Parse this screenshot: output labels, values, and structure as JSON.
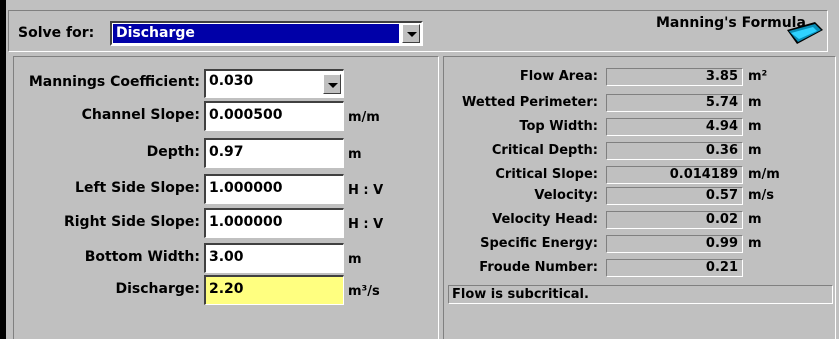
{
  "header": {
    "solve_for_label": "Solve for:",
    "solve_for_value": "Discharge",
    "formula_title": "Manning's Formula",
    "icon": "channel-icon"
  },
  "inputs": {
    "mannings": {
      "label": "Mannings Coefficient:",
      "value": "0.030"
    },
    "slope": {
      "label": "Channel Slope:",
      "value": "0.000500",
      "unit": "m/m"
    },
    "depth": {
      "label": "Depth:",
      "value": "0.97",
      "unit": "m"
    },
    "left_side": {
      "label": "Left Side Slope:",
      "value": "1.000000",
      "unit": "H : V"
    },
    "right_side": {
      "label": "Right Side Slope:",
      "value": "1.000000",
      "unit": "H : V"
    },
    "bottom_width": {
      "label": "Bottom Width:",
      "value": "3.00",
      "unit": "m"
    },
    "discharge": {
      "label": "Discharge:",
      "value": "2.20",
      "unit": "m³/s"
    }
  },
  "results": [
    {
      "label": "Flow Area:",
      "value": "3.85",
      "unit": "m²"
    },
    {
      "label": "Wetted Perimeter:",
      "value": "5.74",
      "unit": "m"
    },
    {
      "label": "Top Width:",
      "value": "4.94",
      "unit": "m"
    },
    {
      "label": "Critical Depth:",
      "value": "0.36",
      "unit": "m"
    },
    {
      "label": "Critical Slope:",
      "value": "0.014189",
      "unit": "m/m"
    },
    {
      "label": "Velocity:",
      "value": "0.57",
      "unit": "m/s"
    },
    {
      "label": "Velocity Head:",
      "value": "0.02",
      "unit": "m"
    },
    {
      "label": "Specific Energy:",
      "value": "0.99",
      "unit": "m"
    },
    {
      "label": "Froude Number:",
      "value": "0.21",
      "unit": ""
    }
  ],
  "status": "Flow is subcritical.",
  "colors": {
    "selection": "#0000a8",
    "highlight_input": "#ffff80",
    "face": "#c0c0c0"
  }
}
